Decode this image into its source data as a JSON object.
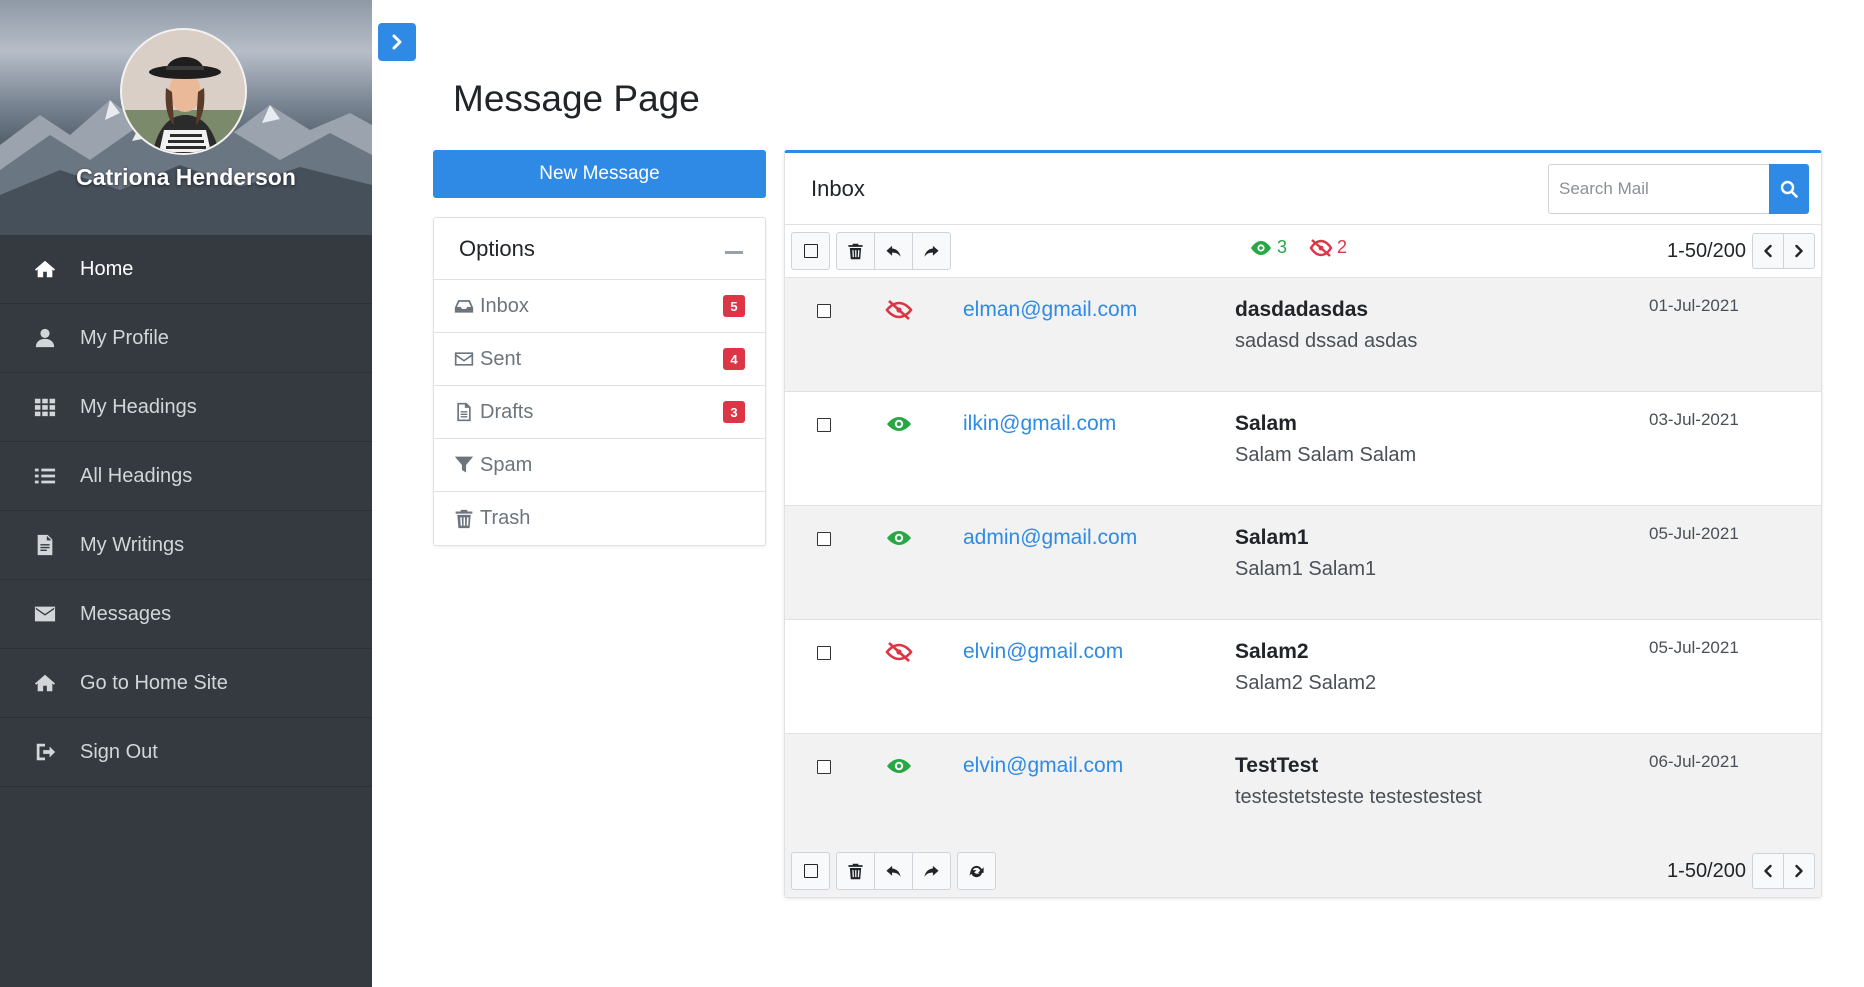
{
  "sidebar": {
    "profile_name": "Catriona Henderson",
    "items": [
      {
        "label": "Home",
        "icon": "home-icon",
        "active": true
      },
      {
        "label": "My Profile",
        "icon": "user-icon",
        "active": false
      },
      {
        "label": "My Headings",
        "icon": "grid-icon",
        "active": false
      },
      {
        "label": "All Headings",
        "icon": "list-icon",
        "active": false
      },
      {
        "label": "My Writings",
        "icon": "document-icon",
        "active": false
      },
      {
        "label": "Messages",
        "icon": "envelope-icon",
        "active": false
      },
      {
        "label": "Go to Home Site",
        "icon": "home-icon",
        "active": false
      },
      {
        "label": "Sign Out",
        "icon": "sign-out-icon",
        "active": false
      }
    ]
  },
  "page": {
    "title": "Message Page",
    "new_message_label": "New Message"
  },
  "options": {
    "title": "Options",
    "folders": [
      {
        "label": "Inbox",
        "icon": "inbox-icon",
        "badge": "5"
      },
      {
        "label": "Sent",
        "icon": "envelope-icon",
        "badge": "4"
      },
      {
        "label": "Drafts",
        "icon": "file-icon",
        "badge": "3"
      },
      {
        "label": "Spam",
        "icon": "filter-icon",
        "badge": ""
      },
      {
        "label": "Trash",
        "icon": "trash-icon",
        "badge": ""
      }
    ]
  },
  "inbox": {
    "title": "Inbox",
    "search_placeholder": "Search Mail",
    "read_count": "3",
    "unread_count": "2",
    "pager_top": "1-50/200",
    "pager_bottom": "1-50/200",
    "messages": [
      {
        "sender": "elman@gmail.com",
        "subject": "dasdadasdas",
        "preview": "sadasd dssad asdas",
        "date": "01-Jul-2021",
        "seen": false
      },
      {
        "sender": "ilkin@gmail.com",
        "subject": "Salam",
        "preview": "Salam Salam Salam",
        "date": "03-Jul-2021",
        "seen": true
      },
      {
        "sender": "admin@gmail.com",
        "subject": "Salam1",
        "preview": "Salam1 Salam1",
        "date": "05-Jul-2021",
        "seen": true
      },
      {
        "sender": "elvin@gmail.com",
        "subject": "Salam2",
        "preview": "Salam2 Salam2",
        "date": "05-Jul-2021",
        "seen": false
      },
      {
        "sender": "elvin@gmail.com",
        "subject": "TestTest",
        "preview": "testestetsteste testestestest",
        "date": "06-Jul-2021",
        "seen": true
      }
    ]
  },
  "colors": {
    "accent": "#2f8ae6",
    "sidebar_bg": "#343a40",
    "badge": "#dc3545",
    "seen": "#28a745",
    "unseen": "#dc3545"
  }
}
